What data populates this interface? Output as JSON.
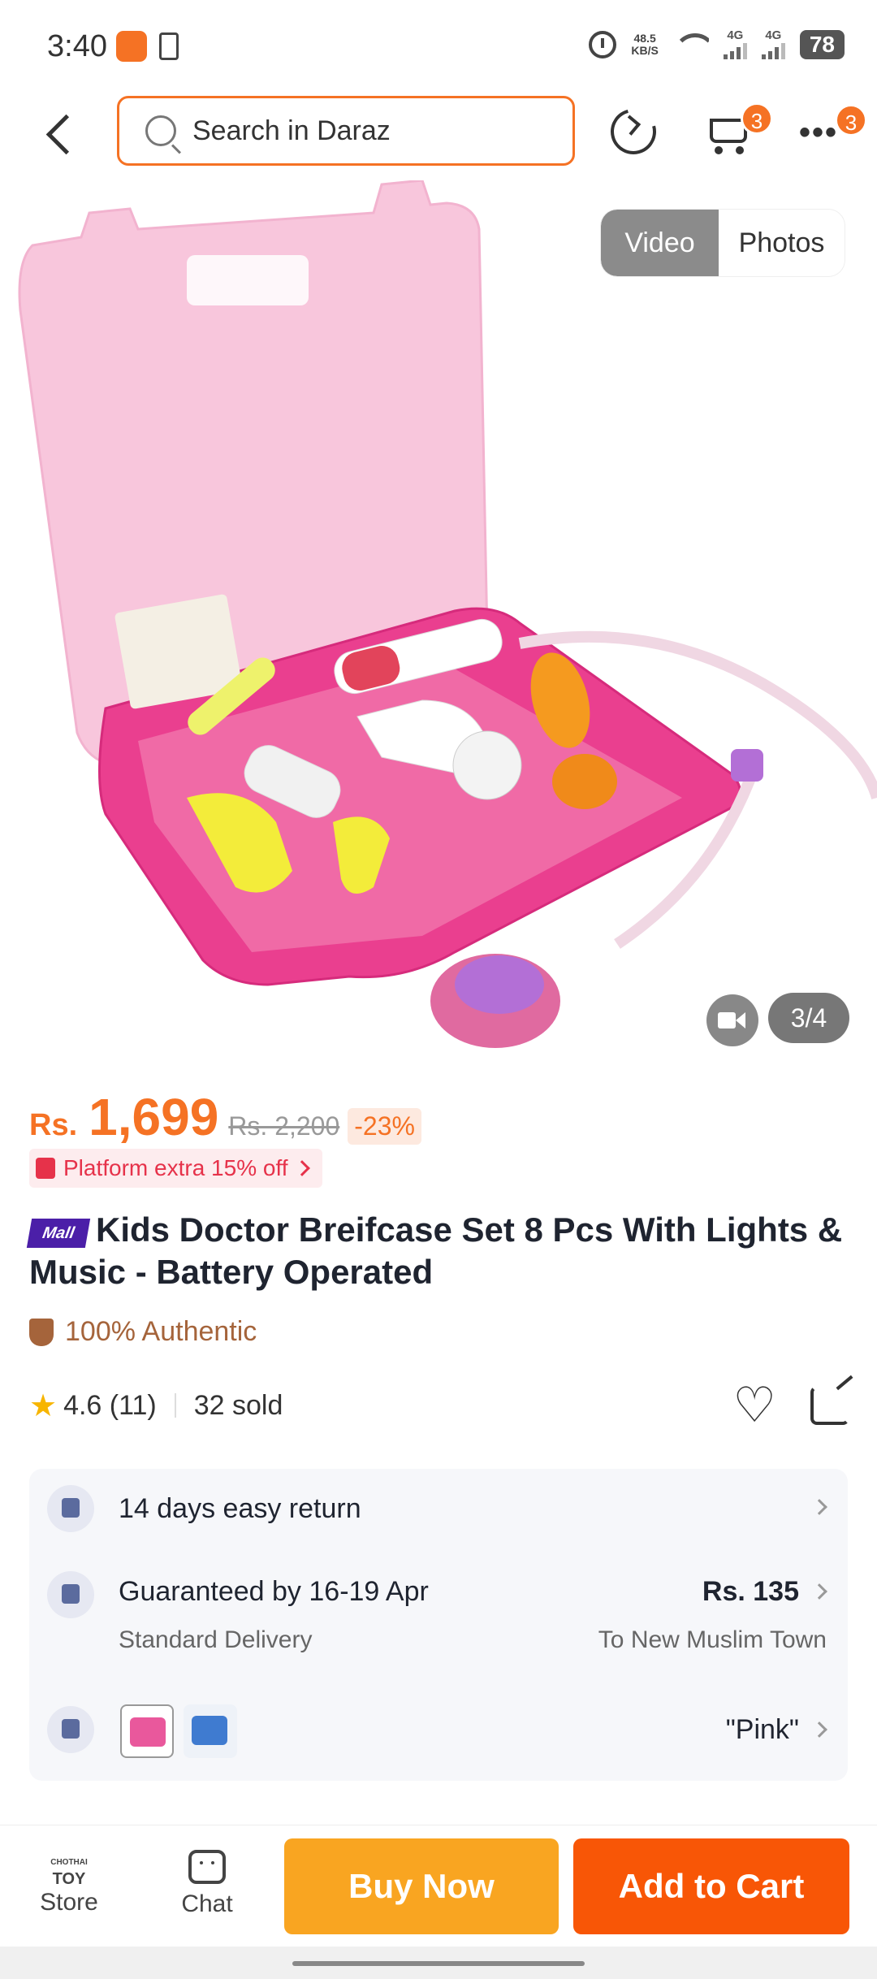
{
  "status_bar": {
    "time": "3:40",
    "net_speed_value": "48.5",
    "net_speed_unit": "KB/S",
    "signal_1": "4G",
    "signal_2": "4G",
    "battery": "78"
  },
  "header": {
    "search_placeholder": "Search in Daraz",
    "cart_badge": "3",
    "more_badge": "3"
  },
  "gallery": {
    "toggle_video": "Video",
    "toggle_photos": "Photos",
    "page_counter": "3/4"
  },
  "product": {
    "currency": "Rs.",
    "price": "1,699",
    "original_price": "Rs. 2,200",
    "discount": "-23%",
    "promo_text": "Platform extra 15% off",
    "mall_badge": "Mall",
    "title": "Kids Doctor Breifcase Set 8 Pcs With Lights & Music - Battery Operated",
    "authentic_text": "100% Authentic",
    "rating": "4.6",
    "rating_count": "(11)",
    "sold": "32 sold"
  },
  "services": {
    "return_text": "14 days easy return",
    "delivery_title": "Guaranteed by 16-19 Apr",
    "delivery_type": "Standard Delivery",
    "delivery_price": "Rs. 135",
    "delivery_location": "To New Muslim Town",
    "variant_value": "\"Pink\""
  },
  "bottom_bar": {
    "store_logo_top": "CHOTHAI",
    "store_logo_bottom": "TOY",
    "store_label": "Store",
    "chat_label": "Chat",
    "buy_now": "Buy Now",
    "add_to_cart": "Add to Cart"
  },
  "colors": {
    "brand_orange": "#f57224",
    "buy_now": "#f9a521",
    "add_to_cart": "#f85606",
    "mall_purple": "#4b1fa8"
  }
}
